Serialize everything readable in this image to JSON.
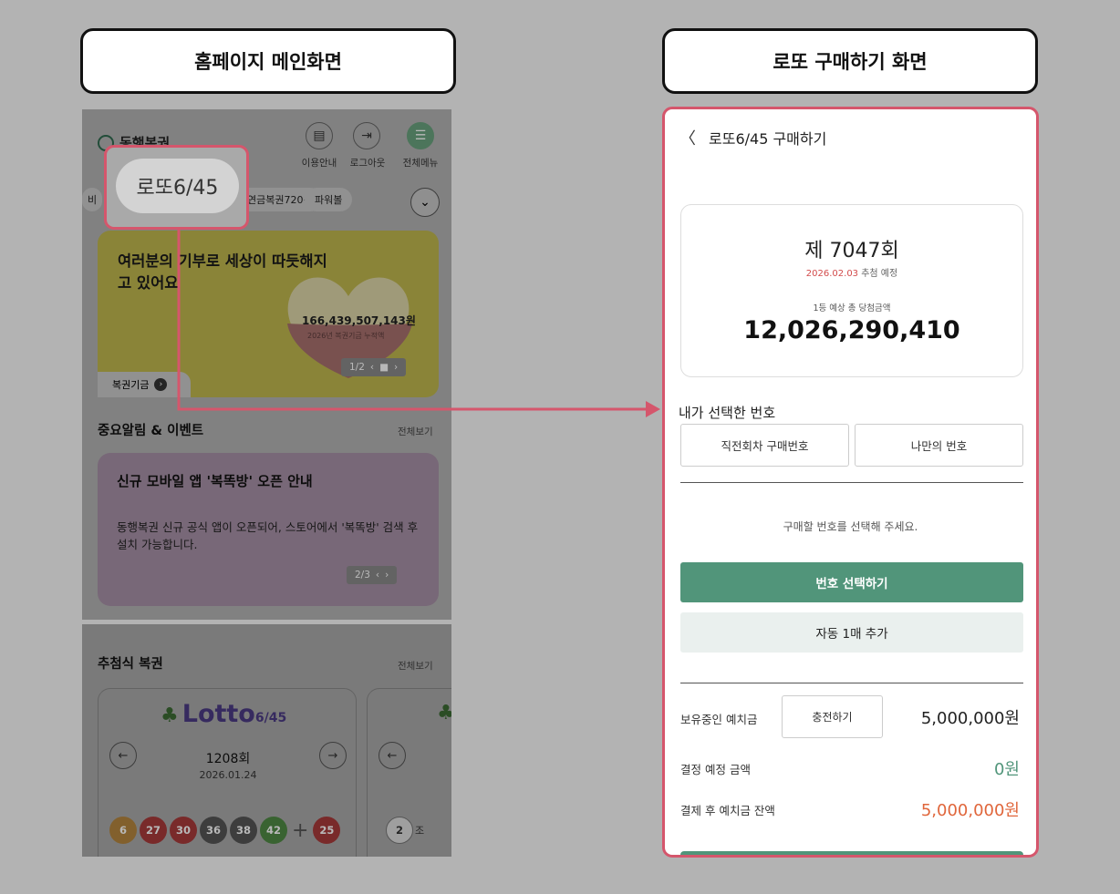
{
  "headers": {
    "left": "홈페이지 메인화면",
    "right": "로또 구매하기 화면"
  },
  "home": {
    "logo": "동행복권",
    "top_buttons": [
      {
        "icon": "book-icon",
        "label": "이용안내"
      },
      {
        "icon": "logout-icon",
        "label": "로그아웃"
      },
      {
        "icon": "menu-icon",
        "label": "전체메뉴"
      }
    ],
    "chips": [
      "비",
      "연금복권720+",
      "파워볼"
    ],
    "highlighted_chip": "로또6/45",
    "banner": {
      "title": "여러분의 기부로 세상이 따듯해지고 있어요",
      "amount": "166,439,507,143원",
      "sub": "2026년 복권기금 누적액",
      "pager": "1/2",
      "tab": "복권기금"
    },
    "events": {
      "title": "중요알림 & 이벤트",
      "see_all": "전체보기",
      "card_title": "신규 모바일 앱 '복똑방' 오픈 안내",
      "card_body": "동행복권 신규 공식 앱이 오픈되어, 스토어에서 '복똑방' 검색 후 설치 가능합니다.",
      "pager": "2/3"
    },
    "lottery": {
      "title": "추첨식 복권",
      "see_all": "전체보기",
      "brand": "Lotto",
      "brand_suffix": "6/45",
      "round": "1208회",
      "date": "2026.01.24",
      "balls": [
        {
          "n": "6",
          "color": "#b5863f"
        },
        {
          "n": "27",
          "color": "#a83a3a"
        },
        {
          "n": "30",
          "color": "#a83a3a"
        },
        {
          "n": "36",
          "color": "#555555"
        },
        {
          "n": "38",
          "color": "#555555"
        },
        {
          "n": "42",
          "color": "#4f8a44"
        }
      ],
      "bonus": {
        "n": "25",
        "color": "#a83a3a"
      },
      "second_card": {
        "ball": "2",
        "text": "조"
      }
    }
  },
  "purchase": {
    "title": "로또6/45 구매하기",
    "draw_no": "제 7047회",
    "draw_date": "2026.02.03",
    "draw_date_suffix": " 추첨 예정",
    "prize_label": "1등 예상 총 당첨금액",
    "prize_amount": "12,026,290,410",
    "my_numbers": "내가 선택한 번호",
    "tabs": [
      "직전회차 구매번호",
      "나만의 번호"
    ],
    "hint": "구매할 번호를 선택해 주세요.",
    "select_btn": "번호 선택하기",
    "auto_btn": "자동 1매 추가",
    "deposit_label": "보유중인 예치금",
    "charge_btn": "충전하기",
    "deposit_value": "5,000,000원",
    "pay_label": "결정 예정 금액",
    "pay_value": "0원",
    "after_label": "결제 후 예치금 잔액",
    "after_value": "5,000,000원",
    "colors": {
      "accent": "#51957a",
      "highlight": "#d5566c",
      "orange": "#e0663b"
    }
  }
}
